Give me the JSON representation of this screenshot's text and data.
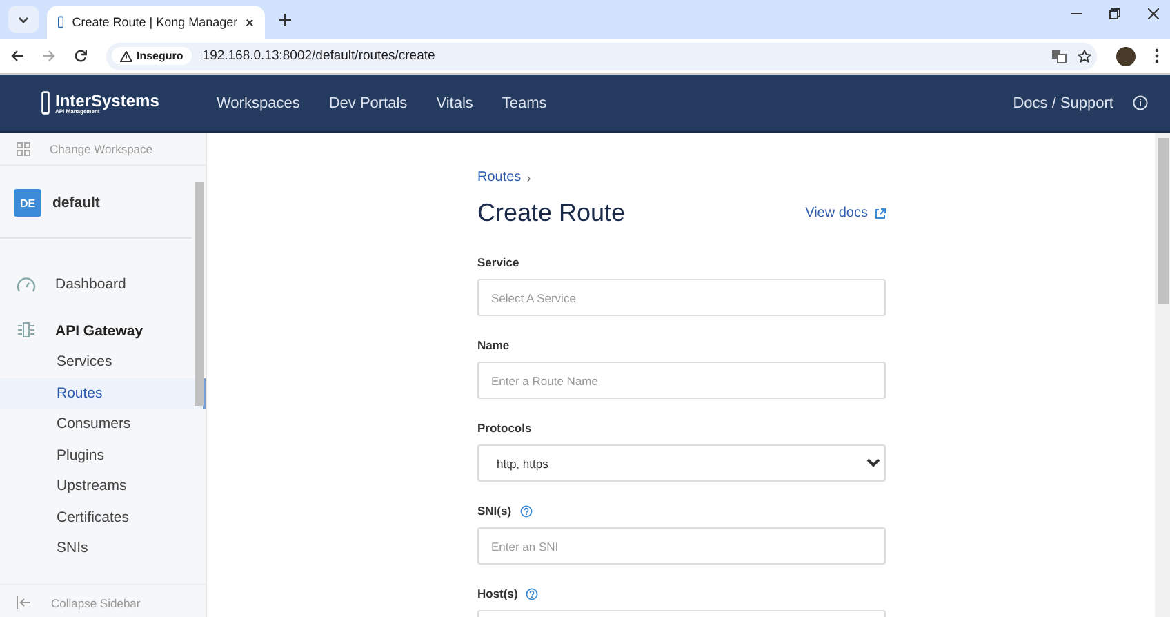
{
  "browser": {
    "tab": {
      "title": "Create Route | Kong Manager"
    },
    "security": "Inseguro",
    "url": "192.168.0.13:8002/default/routes/create"
  },
  "header": {
    "brand": "InterSystems",
    "brand_sub": "API Management",
    "nav": [
      {
        "label": "Workspaces"
      },
      {
        "label": "Dev Portals"
      },
      {
        "label": "Vitals"
      },
      {
        "label": "Teams"
      }
    ],
    "docs": "Docs / Support"
  },
  "sidebar": {
    "change_workspace": "Change Workspace",
    "workspace": {
      "badge": "DE",
      "name": "default"
    },
    "items": [
      {
        "kind": "link",
        "label": "Dashboard"
      },
      {
        "kind": "section",
        "label": "API Gateway",
        "children": [
          {
            "label": "Services",
            "selected": false
          },
          {
            "label": "Routes",
            "selected": true
          },
          {
            "label": "Consumers",
            "selected": false
          },
          {
            "label": "Plugins",
            "selected": false
          },
          {
            "label": "Upstreams",
            "selected": false
          },
          {
            "label": "Certificates",
            "selected": false
          },
          {
            "label": "SNIs",
            "selected": false
          }
        ]
      }
    ],
    "collapse": "Collapse Sidebar"
  },
  "main": {
    "breadcrumb": "Routes",
    "breadcrumb_sep": "›",
    "title": "Create Route",
    "view_docs": "View docs",
    "fields": [
      {
        "kind": "input",
        "label": "Service",
        "help": false,
        "placeholder": "Select A Service"
      },
      {
        "kind": "input",
        "label": "Name",
        "help": false,
        "placeholder": "Enter a Route Name"
      },
      {
        "kind": "select",
        "label": "Protocols",
        "help": false,
        "value": "http, https"
      },
      {
        "kind": "input",
        "label": "SNI(s)",
        "help": true,
        "placeholder": "Enter an SNI"
      },
      {
        "kind": "input",
        "label": "Host(s)",
        "help": true
      }
    ]
  }
}
